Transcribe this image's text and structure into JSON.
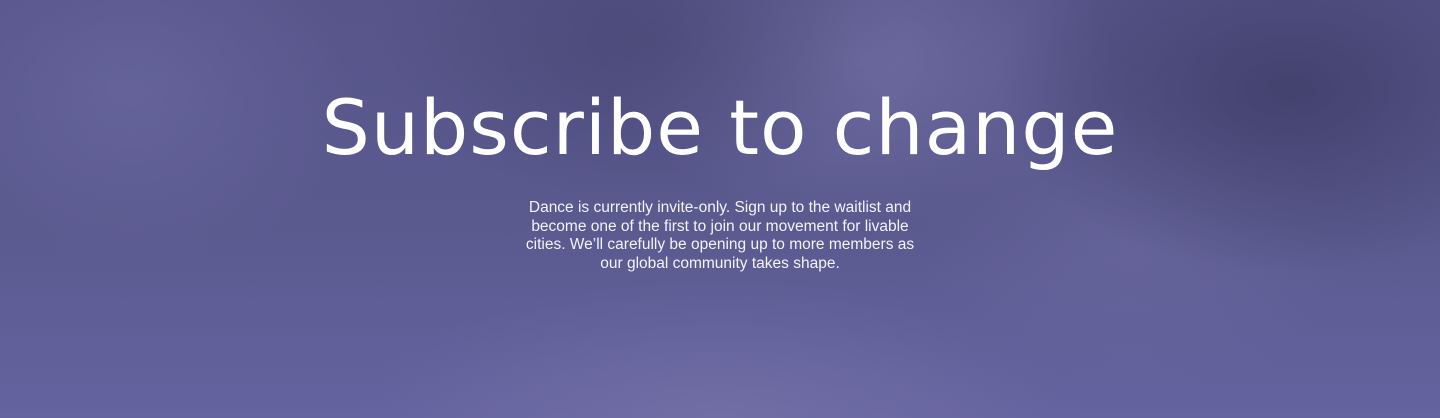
{
  "hero": {
    "title": "Subscribe to change",
    "description": "Dance is currently invite-only. Sign up to the waitlist and become one of the first to join our movement for livable cities. We’ll carefully be opening up to more members as our global community takes shape."
  },
  "colors": {
    "background": "#5c5a8e",
    "text": "#ffffff"
  }
}
